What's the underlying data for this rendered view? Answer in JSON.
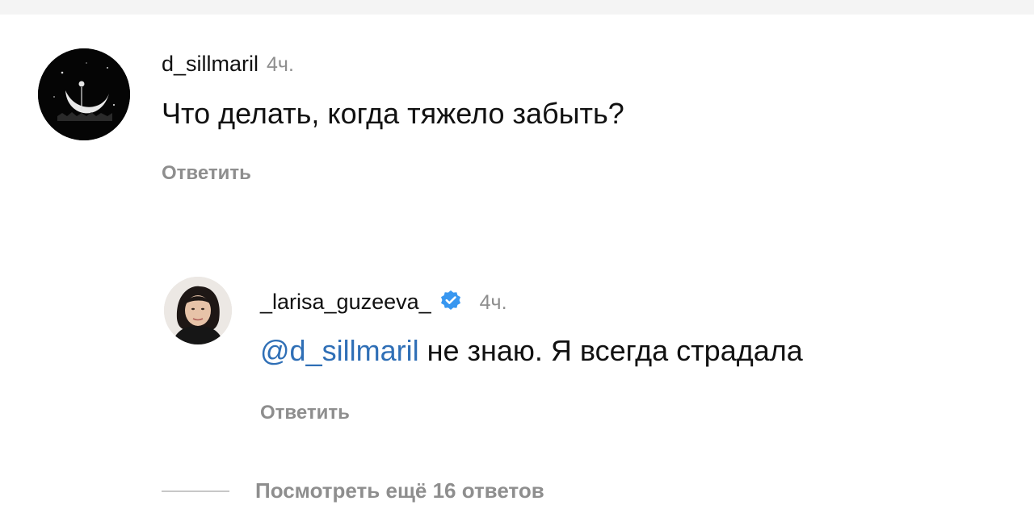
{
  "comment": {
    "username": "d_sillmaril",
    "time": "4ч.",
    "text": "Что делать, когда тяжело забыть?",
    "reply_label": "Ответить",
    "avatar_icon": "moon-avatar-icon"
  },
  "reply": {
    "username": "_larisa_guzeeva_",
    "verified_icon": "verified-badge-icon",
    "time": "4ч.",
    "mention": "@d_sillmaril",
    "text": " не знаю. Я всегда страдала",
    "reply_label": "Ответить",
    "avatar_icon": "profile-photo-avatar"
  },
  "view_more": {
    "label": "Посмотреть ещё 16 ответов"
  },
  "colors": {
    "mention": "#2f6fb6",
    "verified": "#3897f0",
    "muted": "#8e8e8e"
  }
}
